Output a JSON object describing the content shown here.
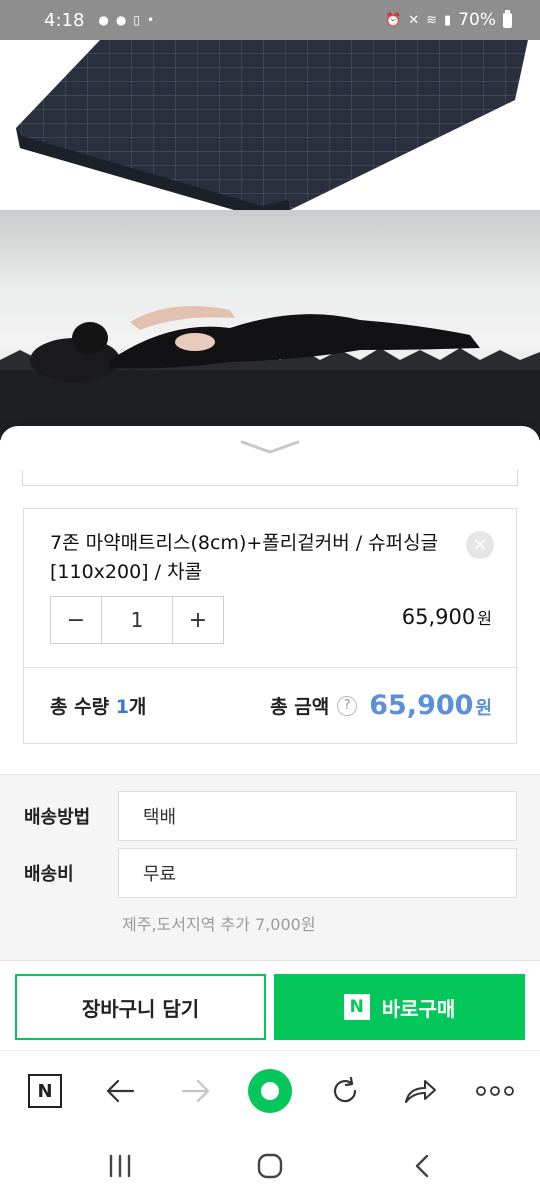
{
  "status_bar": {
    "time": "4:18",
    "battery": "70%"
  },
  "product_image": {
    "alt": "product image"
  },
  "option": {
    "name": "7존 마약매트리스(8cm)+폴리겉커버 / 슈퍼싱글[110x200] / 차콜",
    "quantity": "1",
    "price": "65,900",
    "currency": "원"
  },
  "total": {
    "qty_label": "총 수량",
    "qty_value": "1",
    "qty_unit": "개",
    "amount_label": "총 금액",
    "help": "?",
    "amount": "65,900",
    "currency": "원"
  },
  "delivery": {
    "method_label": "배송방법",
    "method_value": "택배",
    "fee_label": "배송비",
    "fee_value": "무료",
    "note": "제주,도서지역 추가 7,000원"
  },
  "actions": {
    "cart_label": "장바구니 담기",
    "buy_badge": "N",
    "buy_label": "바로구매"
  },
  "browser_bar": {
    "logo": "N"
  },
  "colors": {
    "naver_green": "#03c75a",
    "total_blue": "#5c8fd9"
  }
}
